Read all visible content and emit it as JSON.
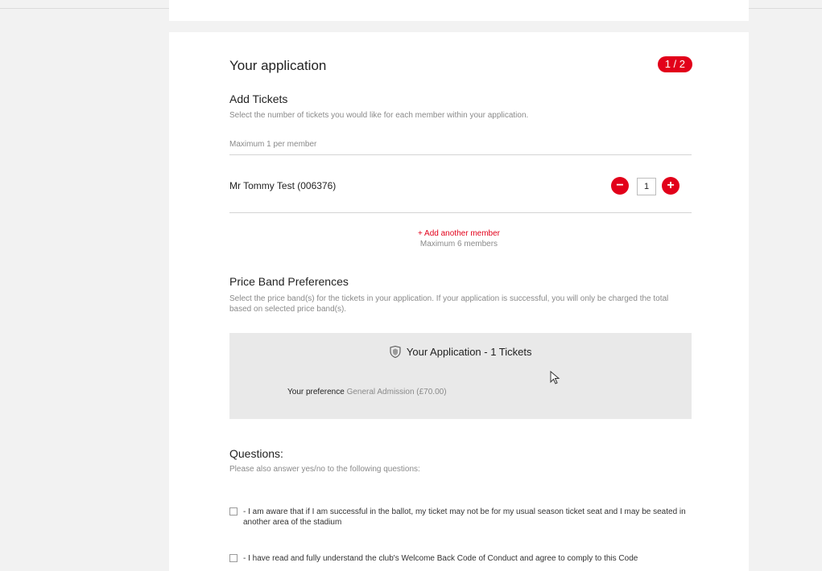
{
  "application": {
    "title": "Your application",
    "step": "1 / 2"
  },
  "tickets": {
    "heading": "Add Tickets",
    "description": "Select the number of tickets you would like for each member within your application.",
    "max_note": "Maximum 1 per member",
    "members": [
      {
        "name": "Mr Tommy Test (006376)",
        "quantity": "1"
      }
    ],
    "decrement_symbol": "−",
    "increment_symbol": "+",
    "add_member_label": "+ Add another member",
    "max_members_note": "Maximum 6 members"
  },
  "price_band": {
    "heading": "Price Band Preferences",
    "description": "Select the price band(s) for the tickets in your application. If your application is successful, you will only be charged the total based on selected price band(s).",
    "box_title": "Your Application - 1 Tickets",
    "preference_label": "Your preference",
    "preference_value": "General Admission (£70.00)"
  },
  "questions": {
    "heading": "Questions:",
    "description": "Please also answer yes/no to the following questions:",
    "items": [
      {
        "text": "- I am aware that if I am successful in the ballot, my ticket may not be for my usual season ticket seat and I may be seated in another area of the stadium"
      },
      {
        "text": "- I have read and fully understand the club's Welcome Back Code of Conduct and agree to comply to this Code"
      }
    ]
  },
  "colors": {
    "accent": "#e2001a",
    "page_bg": "#f2f2f2",
    "card_bg": "#ffffff",
    "pref_box_bg": "#e9e9e9"
  },
  "icons": {
    "club_crest": "club-crest-icon",
    "cursor": "mouse-pointer-icon"
  }
}
